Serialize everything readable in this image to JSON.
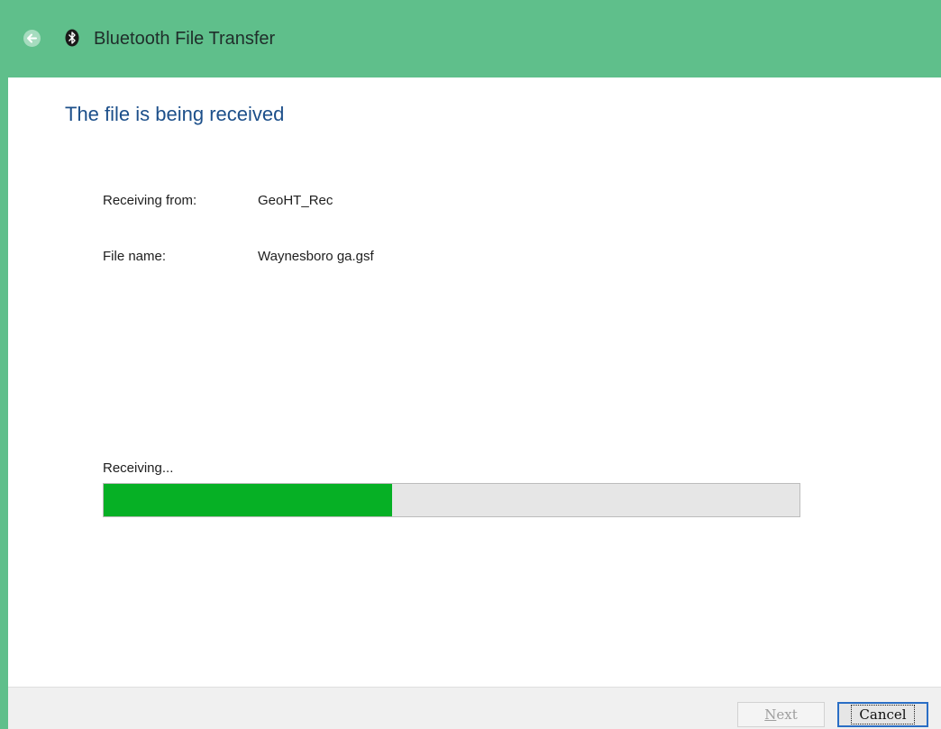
{
  "window": {
    "title": "Bluetooth File Transfer",
    "accent_color": "#5fbf8b",
    "back_icon": "back-arrow-icon",
    "app_icon": "bluetooth-icon"
  },
  "main": {
    "heading": "The file is being received",
    "fields": [
      {
        "label": "Receiving from:",
        "value": "GeoHT_Rec"
      },
      {
        "label": "File name:",
        "value": "Waynesboro ga.gsf"
      }
    ],
    "status": "Receiving...",
    "progress": 0.415,
    "progress_color": "#06b025"
  },
  "footer": {
    "next_label": "Next",
    "cancel_label": "Cancel"
  }
}
